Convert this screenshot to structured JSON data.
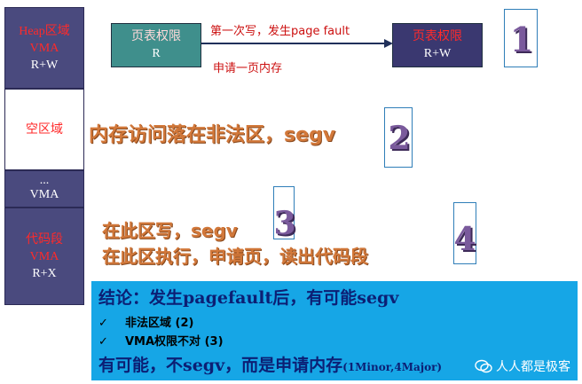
{
  "memory": {
    "heap": {
      "line1": "Heap区域",
      "line2": "VMA",
      "line3": "R+W"
    },
    "empty": {
      "label": "空区域"
    },
    "middle": {
      "dots": "...",
      "label": "VMA"
    },
    "code": {
      "line1": "代码段",
      "line2": "VMA",
      "line3": "R+X"
    }
  },
  "page_table_left": {
    "title": "页表权限",
    "value": "R"
  },
  "page_table_right": {
    "title": "页表权限",
    "value": "R+W"
  },
  "arrow": {
    "top_label": "第一次写，发生page fault",
    "bottom_label": "申请一页内存"
  },
  "cases": {
    "case1": {
      "num": "1"
    },
    "case2": {
      "text": "内存访问落在非法区，segv",
      "num": "2"
    },
    "case3": {
      "text": "在此区写，segv",
      "num": "3"
    },
    "case4": {
      "text": "在此区执行，申请页，读出代码段",
      "num": "4"
    }
  },
  "conclusion": {
    "title": "结论：发生pagefault后，有可能segv",
    "items": [
      {
        "check": "✓",
        "text": "非法区域 (2)"
      },
      {
        "check": "✓",
        "text": "VMA权限不对 (3)"
      }
    ],
    "last_main": "有可能，不segv，而是申请内存",
    "last_small": "(1Minor,4Major)",
    "watermark": "人人都是极客"
  },
  "colors": {
    "vma_bg": "#4a4a7e",
    "pt_left_bg": "#3f8f8c",
    "pt_right_bg": "#3a3870",
    "conclusion_bg": "#16a6e6",
    "accent_orange": "#d2783a"
  }
}
